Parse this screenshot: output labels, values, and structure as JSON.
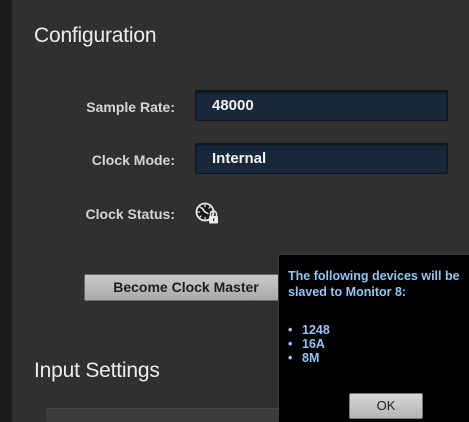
{
  "configuration": {
    "title": "Configuration",
    "sample_rate": {
      "label": "Sample Rate:",
      "value": "48000"
    },
    "clock_mode": {
      "label": "Clock Mode:",
      "value": "Internal"
    },
    "clock_status": {
      "label": "Clock Status:",
      "icon": "clock-locked-icon"
    },
    "become_clock_master_label": "Become Clock Master"
  },
  "input_settings": {
    "title": "Input Settings"
  },
  "popup": {
    "message": "The following devices will be slaved to Monitor 8:",
    "devices": [
      "1248",
      "16A",
      "8M"
    ],
    "bullet": "•",
    "ok_label": "OK"
  },
  "colors": {
    "field_bg": "#17283a",
    "popup_text": "#8fc6f5",
    "panel_bg": "#303030"
  }
}
